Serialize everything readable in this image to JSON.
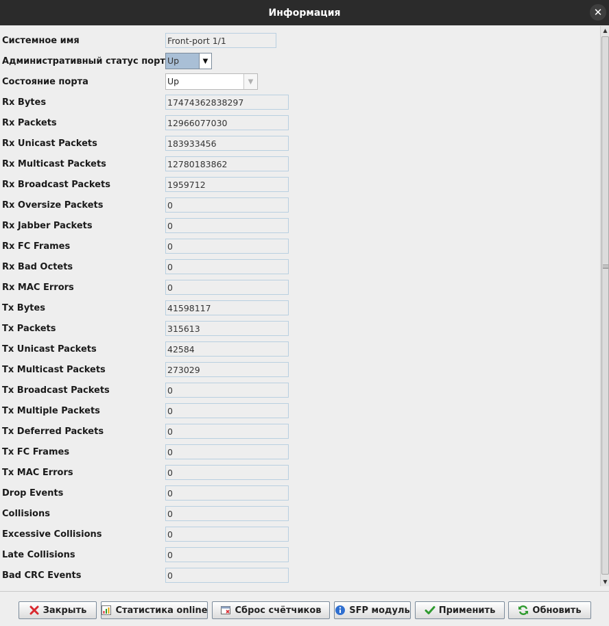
{
  "window": {
    "title": "Информация"
  },
  "form": {
    "system_name": {
      "label": "Системное имя",
      "value": "Front-port 1/1"
    },
    "admin_status": {
      "label": "Административный статус порта",
      "value": "Up"
    },
    "port_state": {
      "label": "Состояние порта",
      "value": "Up"
    },
    "counters": [
      {
        "label": "Rx Bytes",
        "value": "17474362838297"
      },
      {
        "label": "Rx Packets",
        "value": "12966077030"
      },
      {
        "label": "Rx Unicast Packets",
        "value": "183933456"
      },
      {
        "label": "Rx Multicast Packets",
        "value": "12780183862"
      },
      {
        "label": "Rx Broadcast Packets",
        "value": "1959712"
      },
      {
        "label": "Rx Oversize Packets",
        "value": "0"
      },
      {
        "label": "Rx Jabber Packets",
        "value": "0"
      },
      {
        "label": "Rx FC Frames",
        "value": "0"
      },
      {
        "label": "Rx Bad Octets",
        "value": "0"
      },
      {
        "label": "Rx MAC Errors",
        "value": "0"
      },
      {
        "label": "Tx Bytes",
        "value": "41598117"
      },
      {
        "label": "Tx Packets",
        "value": "315613"
      },
      {
        "label": "Tx Unicast Packets",
        "value": "42584"
      },
      {
        "label": "Tx Multicast Packets",
        "value": "273029"
      },
      {
        "label": "Tx Broadcast Packets",
        "value": "0"
      },
      {
        "label": "Tx Multiple Packets",
        "value": "0"
      },
      {
        "label": "Tx Deferred Packets",
        "value": "0"
      },
      {
        "label": "Tx FC Frames",
        "value": "0"
      },
      {
        "label": "Tx MAC Errors",
        "value": "0"
      },
      {
        "label": "Drop Events",
        "value": "0"
      },
      {
        "label": "Collisions",
        "value": "0"
      },
      {
        "label": "Excessive Collisions",
        "value": "0"
      },
      {
        "label": "Late Collisions",
        "value": "0"
      },
      {
        "label": "Bad CRC Events",
        "value": "0"
      }
    ]
  },
  "buttons": {
    "close": {
      "label": "Закрыть",
      "icon": "close-x-icon",
      "color": "#d9282f"
    },
    "stats_online": {
      "label": "Статистика online",
      "icon": "chart-icon"
    },
    "reset_counters": {
      "label": "Сброс счётчиков",
      "icon": "reset-window-icon"
    },
    "sfp_module": {
      "label": "SFP модуль",
      "icon": "info-icon",
      "color": "#2f6fd0"
    },
    "apply": {
      "label": "Применить",
      "icon": "checkmark-icon",
      "color": "#2e9a2e"
    },
    "refresh": {
      "label": "Обновить",
      "icon": "refresh-icon",
      "color": "#2e9a2e"
    }
  }
}
